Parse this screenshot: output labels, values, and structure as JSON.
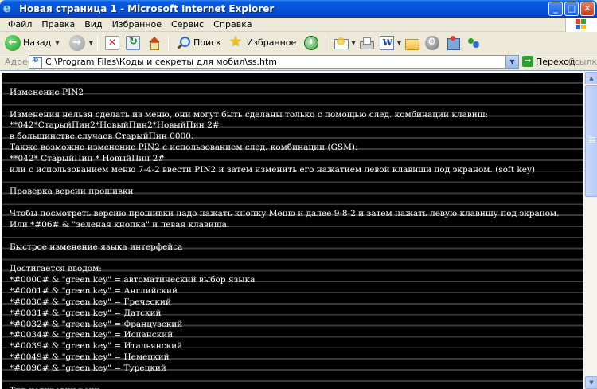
{
  "window": {
    "title": "Новая страница 1 - Microsoft Internet Explorer",
    "minimize": "_",
    "maximize": "□",
    "close": "✕"
  },
  "menu": {
    "items": [
      "Файл",
      "Правка",
      "Вид",
      "Избранное",
      "Сервис",
      "Справка"
    ]
  },
  "toolbar": {
    "back_label": "Назад",
    "search_label": "Поиск",
    "favorites_label": "Избранное"
  },
  "address": {
    "label": "Адрес:",
    "value": "C:\\Program Files\\Коды и секреты для мобил\\ss.htm",
    "go_label": "Переход",
    "links_label": "Ссылки"
  },
  "page": {
    "lines": [
      "",
      "Изменение PIN2",
      "",
      "Изменения нельзя сделать из меню, они могут быть сделаны только с помощью след. комбинации клавиш:",
      "**042*СтарыйПин2*НовыйПин2*НовыйПин 2#",
      "в большинстве случаев СтарыйПин 0000.",
      "Также возможно изменение PIN2 с использованием след. комбинации (GSM):",
      "**042* СтарыйПин * НовыйПин 2#",
      "или с использованием меню 7-4-2 ввести PIN2 и затем изменить его нажатием левой клавиши под экраном. (soft key)",
      "",
      "Проверка версии прошивки",
      "",
      "Чтобы посмотреть версию прошивки надо нажать кнопку Меню и далее 9-8-2 и затем нажать левую клавишу под экраном.",
      "Или *#06# & \"зеленая кнопка\" и левая клавиша.",
      "",
      "Быстрое изменение языка интерфейса",
      "",
      "Достигается вводом:",
      "*#0000# & \"green key\" = автоматический выбор языка",
      "*#0001# & \"green key\" = Английский",
      "*#0030# & \"green key\" = Греческий",
      "*#0031# & \"green key\" = Датский",
      "*#0032# & \"green key\" = Французский",
      "*#0034# & \"green key\" = Испанский",
      "*#0039# & \"green key\" = Итальянский",
      "*#0049# & \"green key\" = Немецкий",
      "*#0090# & \"green key\" = Турецкий",
      "",
      "Тип кодировки речи"
    ]
  },
  "colors": {
    "titlebar": "#0453d8",
    "page_background": "#000000",
    "page_text": "#ffffff",
    "chrome": "#ece9d8"
  }
}
